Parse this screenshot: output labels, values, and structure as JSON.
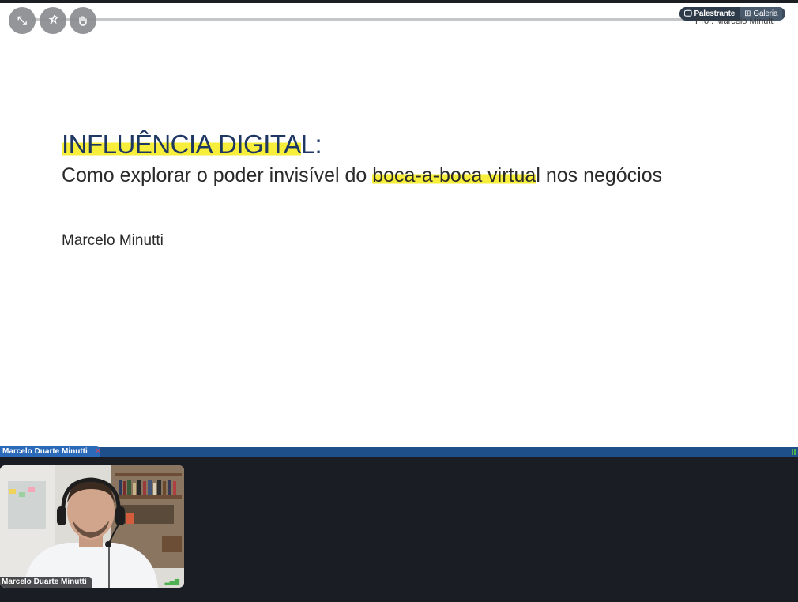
{
  "controls": {
    "exit_fullscreen_icon": "compress-icon",
    "pin_icon": "pin-icon",
    "hand_icon": "raise-hand-icon"
  },
  "view_toggle": {
    "speaker_label": "Palestrante",
    "gallery_label": "Galeria"
  },
  "presenter": {
    "name": "Prof. Marcelo Minutti"
  },
  "slide": {
    "title_part1": "INFLUÊNCIA DIGITA",
    "title_part2": "L:",
    "subtitle_part1": "Como explorar o poder invisível do ",
    "subtitle_highlight": "boca-a-boca virtua",
    "subtitle_part2": "l nos negócios",
    "author": "Marcelo Minutti",
    "highlight_color": "#f6ee3a",
    "title_color": "#1f3863"
  },
  "participant": {
    "top_name": "Marcelo Duarte Minutti",
    "tile_name": "Marcelo Duarte Minutti"
  }
}
